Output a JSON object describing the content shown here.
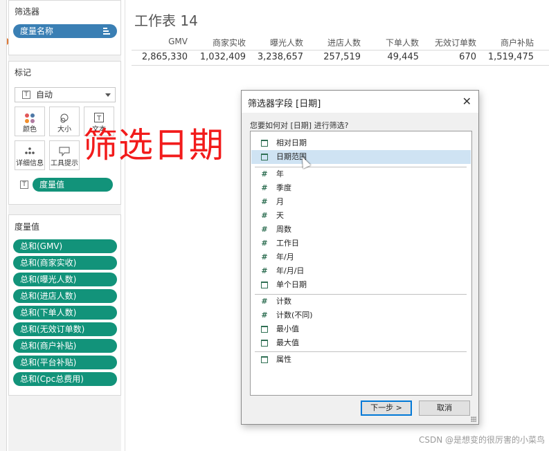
{
  "filters": {
    "title": "筛选器",
    "pill": "度量名称"
  },
  "marks": {
    "title": "标记",
    "type": "自动",
    "type_icon": "T",
    "buttons": [
      {
        "label": "颜色",
        "icon": "color-icon"
      },
      {
        "label": "大小",
        "icon": "size-icon"
      },
      {
        "label": "文本",
        "icon": "text-icon"
      },
      {
        "label": "详细信息",
        "icon": "detail-icon"
      },
      {
        "label": "工具提示",
        "icon": "tooltip-icon"
      }
    ],
    "text_pill_icon": "T",
    "text_pill": "度量值"
  },
  "measure_values": {
    "title": "度量值",
    "items": [
      "总和(GMV)",
      "总和(商家实收)",
      "总和(曝光人数)",
      "总和(进店人数)",
      "总和(下单人数)",
      "总和(无效订单数)",
      "总和(商户补贴)",
      "总和(平台补贴)",
      "总和(Cpc总费用)"
    ]
  },
  "sheet": {
    "title": "工作表 14",
    "headers": [
      "GMV",
      "商家实收",
      "曝光人数",
      "进店人数",
      "下单人数",
      "无效订单数",
      "商户补贴"
    ],
    "values": [
      "2,865,330",
      "1,032,409",
      "3,238,657",
      "257,519",
      "49,445",
      "670",
      "1,519,475"
    ]
  },
  "dialog": {
    "title": "筛选器字段 [日期]",
    "close": "✕",
    "question": "您要如何对 [日期] 进行筛选?",
    "items": [
      {
        "label": "相对日期",
        "icon": "calendar",
        "selected": false
      },
      {
        "label": "日期范围",
        "icon": "calendar",
        "selected": true
      },
      {
        "label": "年",
        "icon": "hash",
        "selected": false
      },
      {
        "label": "季度",
        "icon": "hash",
        "selected": false
      },
      {
        "label": "月",
        "icon": "hash",
        "selected": false
      },
      {
        "label": "天",
        "icon": "hash",
        "selected": false
      },
      {
        "label": "周数",
        "icon": "hash",
        "selected": false
      },
      {
        "label": "工作日",
        "icon": "hash",
        "selected": false
      },
      {
        "label": "年/月",
        "icon": "hash",
        "selected": false
      },
      {
        "label": "年/月/日",
        "icon": "hash",
        "selected": false
      },
      {
        "label": "单个日期",
        "icon": "calendar",
        "selected": false
      },
      {
        "label": "计数",
        "icon": "hash",
        "selected": false
      },
      {
        "label": "计数(不同)",
        "icon": "hash",
        "selected": false
      },
      {
        "label": "最小值",
        "icon": "calendar",
        "selected": false
      },
      {
        "label": "最大值",
        "icon": "calendar",
        "selected": false
      },
      {
        "label": "属性",
        "icon": "calendar",
        "selected": false
      }
    ],
    "next_button": "下一步 >",
    "cancel_button": "取消"
  },
  "overlay": {
    "annotation": "筛选日期"
  },
  "watermark": "CSDN @是想变的很厉害的小菜鸟",
  "colors": {
    "pill_blue": "#3a7fb4",
    "pill_green": "#12937a",
    "annotation_red": "#f21b1b",
    "selection": "#cfe3f3"
  }
}
